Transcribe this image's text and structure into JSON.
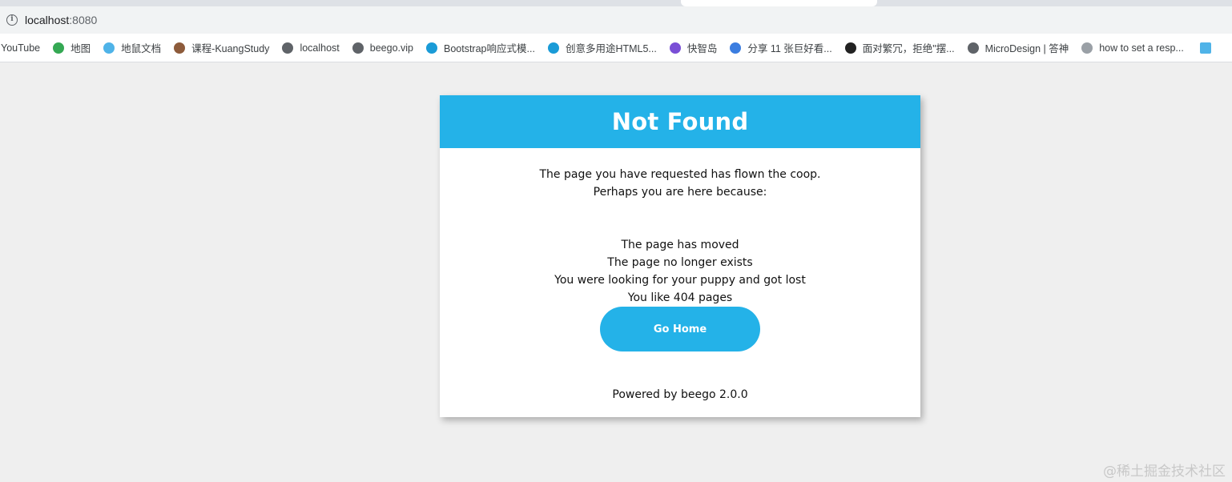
{
  "browser": {
    "url_host": "localhost",
    "url_port": ":8080",
    "bookmarks": [
      {
        "label": "YouTube",
        "icon": "youtube-icon",
        "color": ""
      },
      {
        "label": "地图",
        "icon": "maps-pin-icon",
        "color": "#34a853"
      },
      {
        "label": "地鼠文档",
        "icon": "gopher-icon",
        "color": "#4fb3e8"
      },
      {
        "label": "课程-KuangStudy",
        "icon": "avatar-icon",
        "color": "#8d5b3b"
      },
      {
        "label": "localhost",
        "icon": "globe-icon",
        "color": "#5f6368"
      },
      {
        "label": "beego.vip",
        "icon": "globe-icon",
        "color": "#5f6368"
      },
      {
        "label": "Bootstrap响应式模...",
        "icon": "cloud-icon",
        "color": "#1a9bd7"
      },
      {
        "label": "创意多用途HTML5...",
        "icon": "cloud-icon",
        "color": "#1a9bd7"
      },
      {
        "label": "快智岛",
        "icon": "island-icon",
        "color": "#7a4fd6"
      },
      {
        "label": "分享 11 张巨好看...",
        "icon": "layers-icon",
        "color": "#3b7de0"
      },
      {
        "label": "面对繁冗，拒绝\"摆...",
        "icon": "logo-icon",
        "color": "#222222"
      },
      {
        "label": "MicroDesign | 答神",
        "icon": "globe-icon",
        "color": "#5f6368"
      },
      {
        "label": "how to set a resp...",
        "icon": "image-icon",
        "color": "#9aa0a6"
      }
    ]
  },
  "page": {
    "title": "Not Found",
    "intro_line1": "The page you have requested has flown the coop.",
    "intro_line2": "Perhaps you are here because:",
    "reasons": [
      "The page has moved",
      "The page no longer exists",
      "You were looking for your puppy and got lost",
      "You like 404 pages"
    ],
    "button_label": "Go Home",
    "powered_by": "Powered by beego 2.0.0"
  },
  "watermark": "@稀土掘金技术社区",
  "colors": {
    "accent": "#24b2e8",
    "page_background": "#efefef"
  }
}
